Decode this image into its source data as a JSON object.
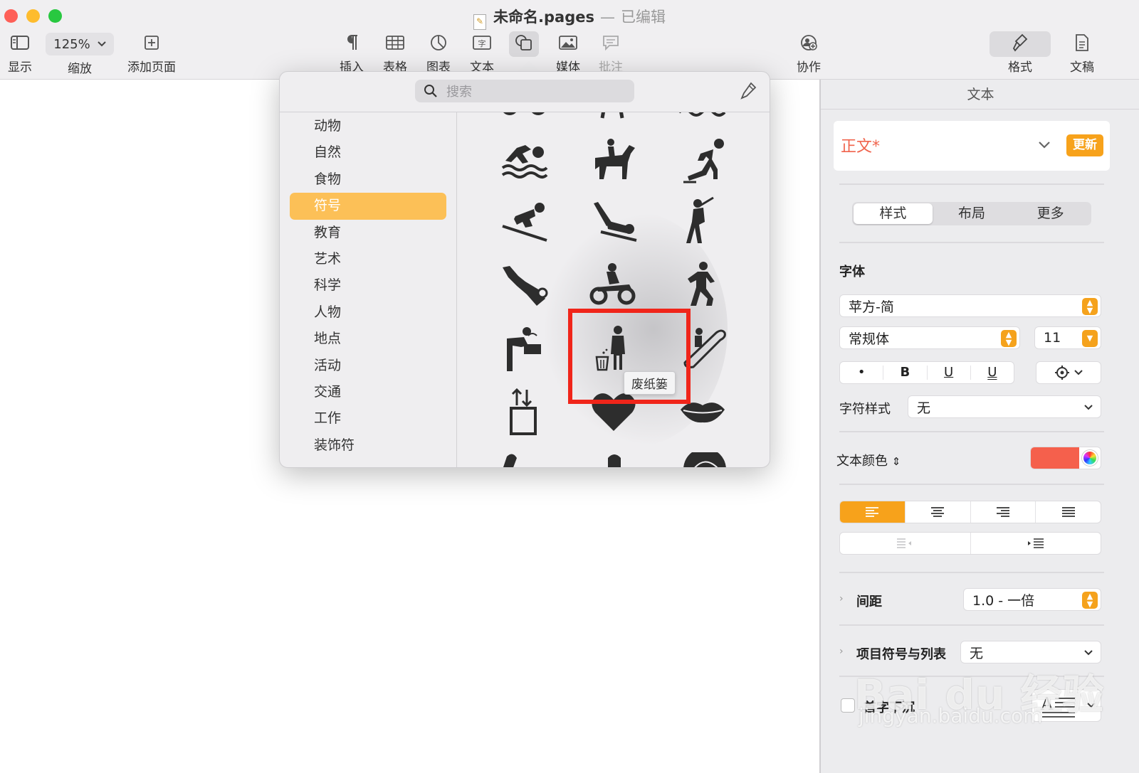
{
  "window": {
    "doc_name": "未命名.pages",
    "separator": "—",
    "status": "已编辑"
  },
  "toolbar": {
    "view_label": "显示",
    "zoom_value": "125%",
    "zoom_label": "缩放",
    "add_page_label": "添加页面",
    "insert_label": "插入",
    "table_label": "表格",
    "chart_label": "图表",
    "text_label": "文本",
    "shape_label": "形状",
    "media_label": "媒体",
    "comment_label": "批注",
    "collaborate_label": "协作",
    "format_label": "格式",
    "document_label": "文稿"
  },
  "shape_picker": {
    "search_placeholder": "搜索",
    "categories": [
      "动物",
      "自然",
      "食物",
      "符号",
      "教育",
      "艺术",
      "科学",
      "人物",
      "地点",
      "活动",
      "交通",
      "工作",
      "装饰符"
    ],
    "selected_category": "符号",
    "tooltip": "废纸篓"
  },
  "sidebar": {
    "title": "文本",
    "paragraph_style": "正文*",
    "update_label": "更新",
    "tabs": [
      "样式",
      "布局",
      "更多"
    ],
    "active_tab": "样式",
    "font_section_label": "字体",
    "font_family": "苹方-简",
    "font_typeface": "常规体",
    "font_size": "11",
    "bold_label": "B",
    "italic_label": "•",
    "underline_label": "U",
    "outline_label": "U",
    "char_style_label": "字符样式",
    "char_style_value": "无",
    "text_color_label": "文本颜色",
    "text_color": "#f5604c",
    "spacing_label": "间距",
    "spacing_value": "1.0 - 一倍",
    "bullets_label": "项目符号与列表",
    "bullets_value": "无",
    "dropcap_label": "首字下沉"
  },
  "colors": {
    "accent": "#f7a21b",
    "selected_category": "#fcc057",
    "highlight_box": "#f0251a"
  },
  "watermark": {
    "main": "Bai du 经验",
    "sub": "jingyan.baidu.com"
  }
}
